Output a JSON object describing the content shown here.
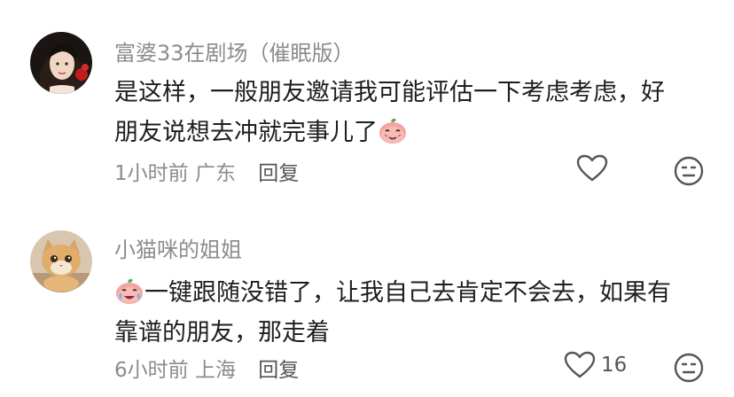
{
  "comments": [
    {
      "username": "富婆33在剧场（催眠版）",
      "text_line1": "是这样，一般朋友邀请我可能评估一下考虑考虑，好",
      "text_line2": "朋友说想去冲就完事儿了",
      "time": "1小时前",
      "location": "广东",
      "reply_label": "回复",
      "like_count": "",
      "avatar_icon": "woman-portrait-avatar",
      "emoji_icon": "blushing-face-emoji"
    },
    {
      "username": "小猫咪的姐姐",
      "text_line1": "一键跟随没错了，让我自己去肯定不会去，如果有",
      "text_line2": "靠谱的朋友，那走着",
      "time": "6小时前",
      "location": "上海",
      "reply_label": "回复",
      "like_count": "16",
      "avatar_icon": "cat-avatar",
      "emoji_icon": "crying-laugh-emoji"
    }
  ],
  "colors": {
    "meta_gray": "#8c8c8c",
    "text_dark": "#1e1e1e",
    "emoji_pink": "#f08a88",
    "emoji_leaf": "#5aa64a"
  }
}
